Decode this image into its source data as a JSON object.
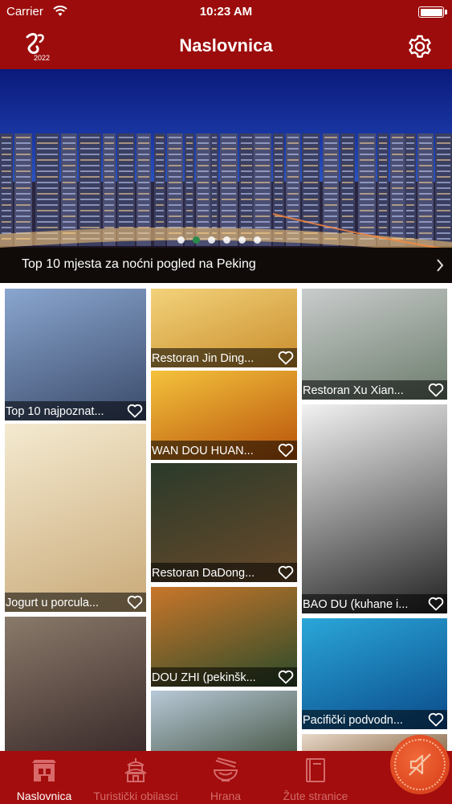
{
  "status_bar": {
    "carrier": "Carrier",
    "time": "10:23 AM"
  },
  "nav": {
    "title": "Naslovnica",
    "logo_text": "2022"
  },
  "hero": {
    "caption": "Top 10 mjesta za noćni pogled na Peking",
    "page_count": 6,
    "active_page": 2
  },
  "tiles": [
    {
      "label": "Top 10 najpoznat...",
      "image": "great-wall-snow",
      "colors": [
        "#8aa6cf",
        "#3a4a6a"
      ]
    },
    {
      "label": "Restoran Jin Ding...",
      "image": "egg-tarts",
      "colors": [
        "#f3d27a",
        "#c98d2c"
      ]
    },
    {
      "label": "Restoran Xu Xian...",
      "image": "modern-building",
      "colors": [
        "#c9cccc",
        "#6c7c6c"
      ]
    },
    {
      "label": "WAN DOU HUAN...",
      "image": "pea-cake",
      "colors": [
        "#f4c23c",
        "#b8520a"
      ]
    },
    {
      "label": "Jogurt u porcula...",
      "image": "yogurt-jar",
      "colors": [
        "#f4ead0",
        "#c9a978"
      ]
    },
    {
      "label": "Restoran DaDong...",
      "image": "restaurant-sign",
      "colors": [
        "#2a3a2a",
        "#6a4a2a"
      ]
    },
    {
      "label": "BAO DU (kuhane i...",
      "image": "tripe-dish",
      "colors": [
        "#f2f2f2",
        "#222222"
      ]
    },
    {
      "label": "DOU ZHI (pekinšk...",
      "image": "douzhi-bowl",
      "colors": [
        "#c9762a",
        "#2a4a2a"
      ]
    },
    {
      "label": "Pacifički podvodn...",
      "image": "aquarium-fish",
      "colors": [
        "#2aa6d8",
        "#0a4a8a"
      ]
    },
    {
      "label": "",
      "image": "hutong-dolls",
      "colors": [
        "#8a7a6a",
        "#3a2a2a"
      ]
    },
    {
      "label": "",
      "image": "beihai-park",
      "colors": [
        "#b8c9d8",
        "#4a5a4a"
      ]
    },
    {
      "label": "",
      "image": "pavilion",
      "colors": [
        "#e8d8c8",
        "#8a6a4a"
      ]
    }
  ],
  "tabs": [
    {
      "label": "Naslovnica",
      "icon": "home-gate-icon",
      "active": true
    },
    {
      "label": "Turistički obilasci",
      "icon": "temple-icon",
      "active": false
    },
    {
      "label": "Hrana",
      "icon": "bowl-chopsticks-icon",
      "active": false
    },
    {
      "label": "Žute stranice",
      "icon": "book-icon",
      "active": false
    }
  ],
  "colors": {
    "brand_red": "#9c0c0c",
    "tab_inactive": "#d46a6a",
    "fab_orange": "#e04a22"
  }
}
